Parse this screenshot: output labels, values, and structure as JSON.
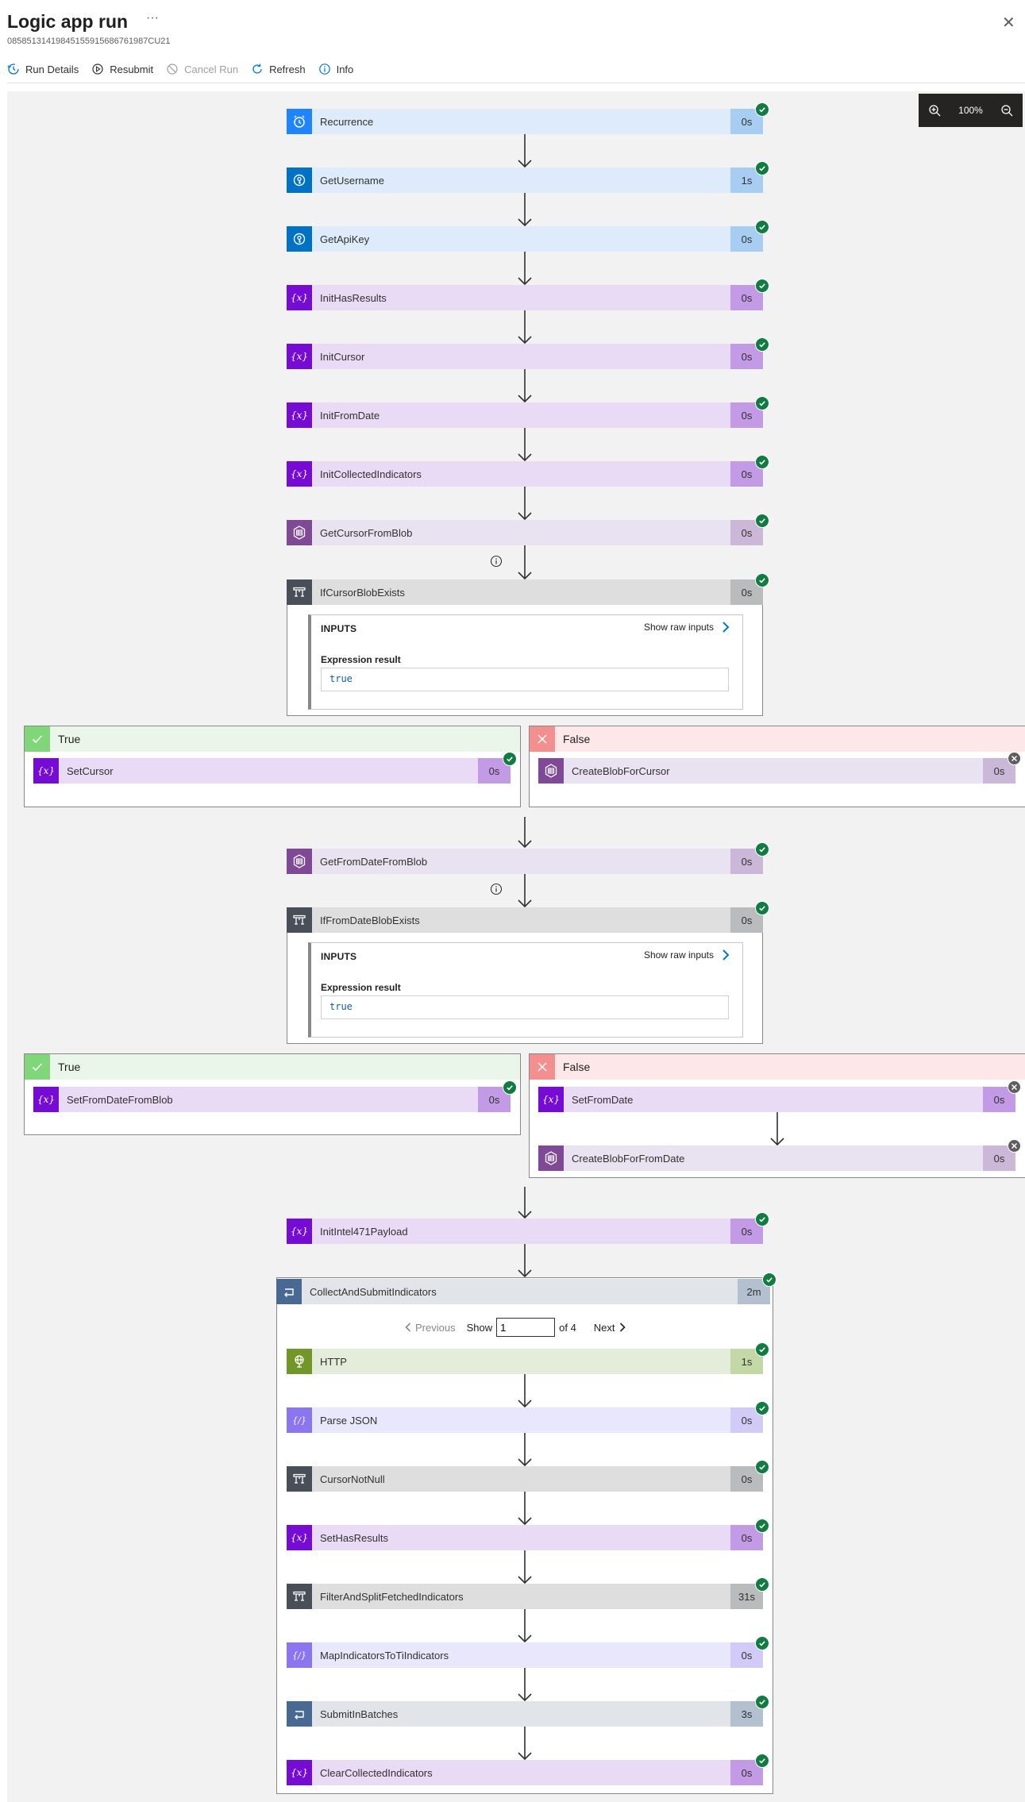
{
  "header": {
    "title": "Logic app run",
    "more": "···",
    "run_id": "08585131419845155915686761987CU21",
    "close": "✕"
  },
  "toolbar": {
    "run_details": "Run Details",
    "resubmit": "Resubmit",
    "cancel_run": "Cancel Run",
    "refresh": "Refresh",
    "info": "Info"
  },
  "zoom": {
    "level": "100%"
  },
  "colors": {
    "blue_bg": "#ddebfa",
    "blue_icon": "#1f85ff",
    "blue_dur": "#a8cdf2",
    "purple_bg": "#e9daf5",
    "purple_icon": "#770bd6",
    "purple_dur": "#c39ae6",
    "blob_bg": "#e9e3f1",
    "blob_icon": "#804998",
    "blob_dur": "#cbb7d8",
    "cond_bg": "#dedede",
    "cond_icon": "#484f58",
    "cond_dur": "#b9bbbd",
    "http_bg": "#e4edd9",
    "http_icon": "#709727",
    "http_dur": "#c4d7a7",
    "json_bg": "#e9e7fb",
    "json_icon": "#8c75f0",
    "json_dur": "#d3cbf7",
    "loop_bg": "#e1e5ea",
    "loop_icon": "#486991",
    "loop_dur": "#b3c0cf",
    "success": "#107c41",
    "true_bg": "#eaf6e9",
    "true_icon": "#7fd779",
    "false_bg": "#fde7e9",
    "false_icon": "#f48f8f"
  },
  "actions": {
    "recurrence": {
      "name": "Recurrence",
      "duration": "0s",
      "icon": "clock-icon",
      "status": "succeeded"
    },
    "get_username": {
      "name": "GetUsername",
      "duration": "1s",
      "icon": "key-vault-icon",
      "status": "succeeded"
    },
    "get_api_key": {
      "name": "GetApiKey",
      "duration": "0s",
      "icon": "key-vault-icon",
      "status": "succeeded"
    },
    "init_has_results": {
      "name": "InitHasResults",
      "duration": "0s",
      "icon": "variable-icon",
      "status": "succeeded"
    },
    "init_cursor": {
      "name": "InitCursor",
      "duration": "0s",
      "icon": "variable-icon",
      "status": "succeeded"
    },
    "init_from_date": {
      "name": "InitFromDate",
      "duration": "0s",
      "icon": "variable-icon",
      "status": "succeeded"
    },
    "init_collected_indicators": {
      "name": "InitCollectedIndicators",
      "duration": "0s",
      "icon": "variable-icon",
      "status": "succeeded"
    },
    "get_cursor_from_blob": {
      "name": "GetCursorFromBlob",
      "duration": "0s",
      "icon": "blob-icon",
      "status": "succeeded"
    },
    "if_cursor_blob_exists": {
      "name": "IfCursorBlobExists",
      "duration": "0s",
      "icon": "condition-icon",
      "status": "succeeded",
      "inputs_label": "INPUTS",
      "show_raw": "Show raw inputs",
      "expression_label": "Expression result",
      "expression_value": "true"
    },
    "branch1_true": {
      "label": "True",
      "action": {
        "name": "SetCursor",
        "duration": "0s",
        "icon": "variable-icon",
        "status": "succeeded"
      }
    },
    "branch1_false": {
      "label": "False",
      "action": {
        "name": "CreateBlobForCursor",
        "duration": "0s",
        "icon": "blob-icon",
        "status": "skipped"
      }
    },
    "get_from_date_from_blob": {
      "name": "GetFromDateFromBlob",
      "duration": "0s",
      "icon": "blob-icon",
      "status": "succeeded"
    },
    "if_from_date_blob_exists": {
      "name": "IfFromDateBlobExists",
      "duration": "0s",
      "icon": "condition-icon",
      "status": "succeeded",
      "inputs_label": "INPUTS",
      "show_raw": "Show raw inputs",
      "expression_label": "Expression result",
      "expression_value": "true"
    },
    "branch2_true": {
      "label": "True",
      "action": {
        "name": "SetFromDateFromBlob",
        "duration": "0s",
        "icon": "variable-icon",
        "status": "succeeded"
      }
    },
    "branch2_false": {
      "label": "False",
      "action1": {
        "name": "SetFromDate",
        "duration": "0s",
        "icon": "variable-icon",
        "status": "skipped"
      },
      "action2": {
        "name": "CreateBlobForFromDate",
        "duration": "0s",
        "icon": "blob-icon",
        "status": "skipped"
      }
    },
    "init_intel471_payload": {
      "name": "InitIntel471Payload",
      "duration": "0s",
      "icon": "variable-icon",
      "status": "succeeded"
    },
    "collect_and_submit": {
      "name": "CollectAndSubmitIndicators",
      "duration": "2m",
      "icon": "loop-icon",
      "status": "succeeded",
      "pager": {
        "previous": "Previous",
        "show": "Show",
        "value": "1",
        "of": "of 4",
        "next": "Next"
      },
      "steps": [
        {
          "name": "HTTP",
          "duration": "1s",
          "icon": "http-icon",
          "status": "succeeded"
        },
        {
          "name": "Parse JSON",
          "duration": "0s",
          "icon": "json-icon",
          "status": "succeeded"
        },
        {
          "name": "CursorNotNull",
          "duration": "0s",
          "icon": "condition-icon",
          "status": "succeeded"
        },
        {
          "name": "SetHasResults",
          "duration": "0s",
          "icon": "variable-icon",
          "status": "succeeded"
        },
        {
          "name": "FilterAndSplitFetchedIndicators",
          "duration": "31s",
          "icon": "condition-icon",
          "status": "succeeded"
        },
        {
          "name": "MapIndicatorsToTiIndicators",
          "duration": "0s",
          "icon": "json-icon",
          "status": "succeeded"
        },
        {
          "name": "SubmitInBatches",
          "duration": "3s",
          "icon": "loop-icon",
          "status": "succeeded"
        },
        {
          "name": "ClearCollectedIndicators",
          "duration": "0s",
          "icon": "variable-icon",
          "status": "succeeded"
        }
      ]
    }
  }
}
